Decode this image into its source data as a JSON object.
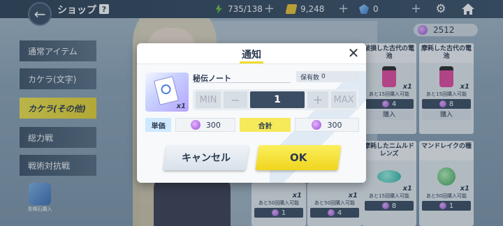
{
  "header": {
    "title": "ショップ",
    "help": "?",
    "ap": "735/138",
    "credits": "9,248",
    "gems": "0"
  },
  "categories": [
    {
      "label": "通常アイテム"
    },
    {
      "label": "カケラ(文字)"
    },
    {
      "label": "カケラ(その他)"
    },
    {
      "label": "総力戦"
    },
    {
      "label": "戦術対抗戦"
    }
  ],
  "side_item": {
    "label": "青輝石購入"
  },
  "currency_balance": "2512",
  "cards": [
    {
      "title": "",
      "count": "",
      "note": "",
      "price": "",
      "buy": ""
    },
    {
      "title": "破損した古代の電池",
      "count": "x1",
      "note": "あと15回購入可能",
      "price": "4",
      "buy": "購入"
    },
    {
      "title": "摩耗した古代の電池",
      "count": "x1",
      "note": "あと15回購入可能",
      "price": "8",
      "buy": "購入"
    },
    {
      "title": "",
      "count": "x1",
      "note": "あと50回購入可能",
      "price": "1",
      "buy": ""
    },
    {
      "title": "",
      "count": "x1",
      "note": "あと50回購入可能",
      "price": "4",
      "buy": ""
    },
    {
      "title": "摩耗したニムルドレンズ",
      "count": "x1",
      "note": "あと15回購入可能",
      "price": "8",
      "buy": ""
    },
    {
      "title": "マンドレイクの種",
      "count": "x1",
      "note": "あと50回購入可能",
      "price": "1",
      "buy": ""
    }
  ],
  "modal": {
    "title": "通知",
    "item_name": "秘伝ノート",
    "owned_label": "保有数",
    "owned_value": "0",
    "thumb_count": "x1",
    "min": "MIN",
    "minus": "−",
    "quantity": "1",
    "plus": "+",
    "max": "MAX",
    "unit_price_label": "単価",
    "unit_price": "300",
    "total_label": "合計",
    "total": "300",
    "cancel": "キャンセル",
    "ok": "OK"
  }
}
